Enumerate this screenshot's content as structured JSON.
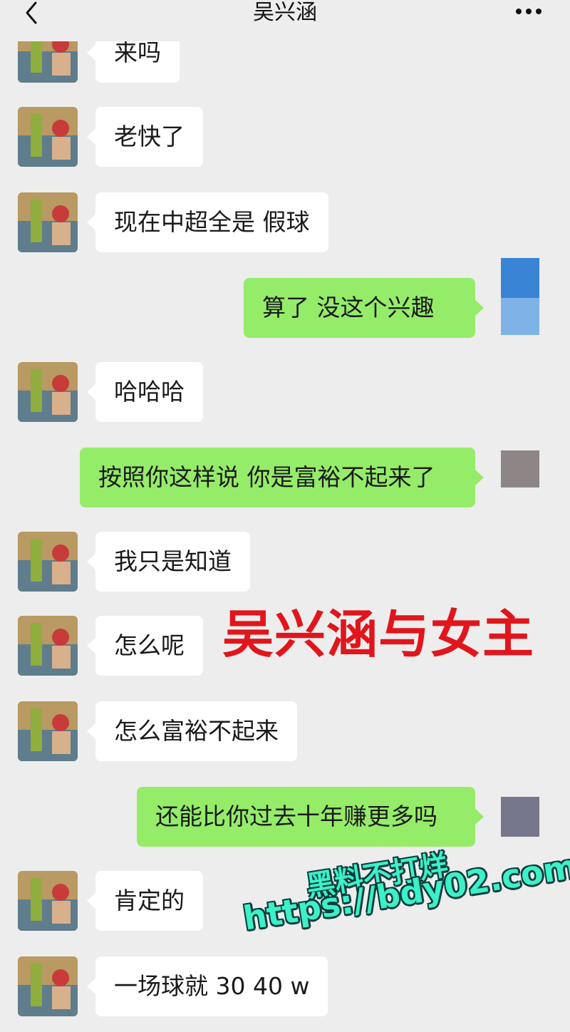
{
  "header": {
    "title": "吴兴涵",
    "back_icon": "chevron-left-icon",
    "more_icon": "ellipsis-icon"
  },
  "messages": [
    {
      "side": "in",
      "text": "来吗"
    },
    {
      "side": "in",
      "text": "老快了"
    },
    {
      "side": "in",
      "text": "现在中超全是 假球"
    },
    {
      "side": "out",
      "text": "算了 没这个兴趣"
    },
    {
      "side": "in",
      "text": "哈哈哈"
    },
    {
      "side": "out",
      "text": "按照你这样说 你是富裕不起来了"
    },
    {
      "side": "in",
      "text": "我只是知道"
    },
    {
      "side": "in",
      "text": "怎么呢"
    },
    {
      "side": "in",
      "text": "怎么富裕不起来"
    },
    {
      "side": "out",
      "text": "还能比你过去十年赚更多吗"
    },
    {
      "side": "in",
      "text": "肯定的"
    },
    {
      "side": "in",
      "text": "一场球就 30 40 w"
    }
  ],
  "overlay": {
    "caption": "吴兴涵与女主",
    "watermark_line1": "黑料不打烊",
    "watermark_line2": "https://bdy02.com"
  },
  "colors": {
    "background": "#ededed",
    "incoming_bubble": "#ffffff",
    "outgoing_bubble": "#95ec69",
    "caption": "#e0161c",
    "watermark": "#3cf0c8"
  }
}
